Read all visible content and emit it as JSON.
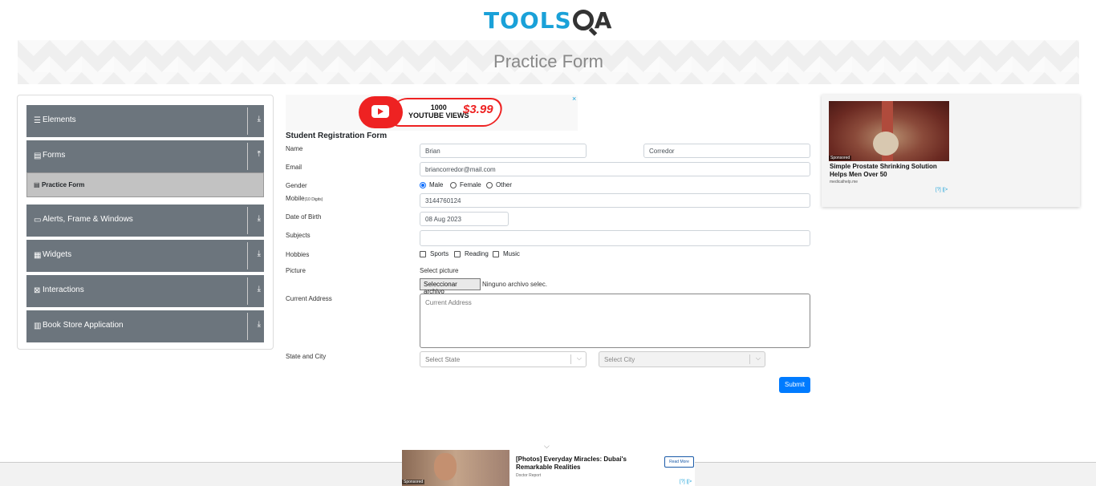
{
  "header": {
    "logo_part1": "TOOLS",
    "logo_part2": "A",
    "page_title": "Practice Form"
  },
  "sidebar": {
    "groups": [
      {
        "label": "Elements",
        "icon": "list-icon",
        "arrow": "download-arrow-icon"
      },
      {
        "label": "Forms",
        "icon": "document-icon",
        "arrow": "upload-arrow-icon"
      },
      {
        "label": "Alerts, Frame & Windows",
        "icon": "window-icon",
        "arrow": "download-arrow-icon"
      },
      {
        "label": "Widgets",
        "icon": "grid-icon",
        "arrow": "download-arrow-icon"
      },
      {
        "label": "Interactions",
        "icon": "interaction-icon",
        "arrow": "download-arrow-icon"
      },
      {
        "label": "Book Store Application",
        "icon": "bookstore-icon",
        "arrow": "download-arrow-icon"
      }
    ],
    "active_item": "Practice Form"
  },
  "ad_top": {
    "line1": "1000",
    "line2": "YOUTUBE VIEWS",
    "price": "$3.99",
    "close": "×"
  },
  "form": {
    "title": "Student Registration Form",
    "labels": {
      "name": "Name",
      "email": "Email",
      "gender": "Gender",
      "mobile": "Mobile",
      "mobile_hint": "(10 Digits)",
      "dob": "Date of Birth",
      "subjects": "Subjects",
      "hobbies": "Hobbies",
      "picture": "Picture",
      "address": "Current Address",
      "state_city": "State and City"
    },
    "first_name": "Brian",
    "last_name": "Corredor",
    "email": "briancorredor@mail.com",
    "gender_options": [
      "Male",
      "Female",
      "Other"
    ],
    "gender_selected": "Male",
    "mobile": "3144760124",
    "dob": "08 Aug 2023",
    "subjects": "",
    "hobby_options": [
      "Sports",
      "Reading",
      "Music"
    ],
    "picture_label": "Select picture",
    "file_button": "Seleccionar archivo",
    "file_status": "Ninguno archivo selec.",
    "address_placeholder": "Current Address",
    "state_placeholder": "Select State",
    "city_placeholder": "Select City",
    "submit": "Submit"
  },
  "ad_right": {
    "sponsored": "Sponsored",
    "title": "Simple Prostate Shrinking Solution Helps Men Over 50",
    "source": "medicalhelp.me",
    "adchoices": "[?] |[>"
  },
  "ad_bottom": {
    "sponsored": "Sponsored",
    "title": "[Photos] Everyday Miracles: Dubai's Remarkable Realities",
    "source": "Doctor Report",
    "button": "Read More",
    "adchoices": "[?] |[>"
  }
}
